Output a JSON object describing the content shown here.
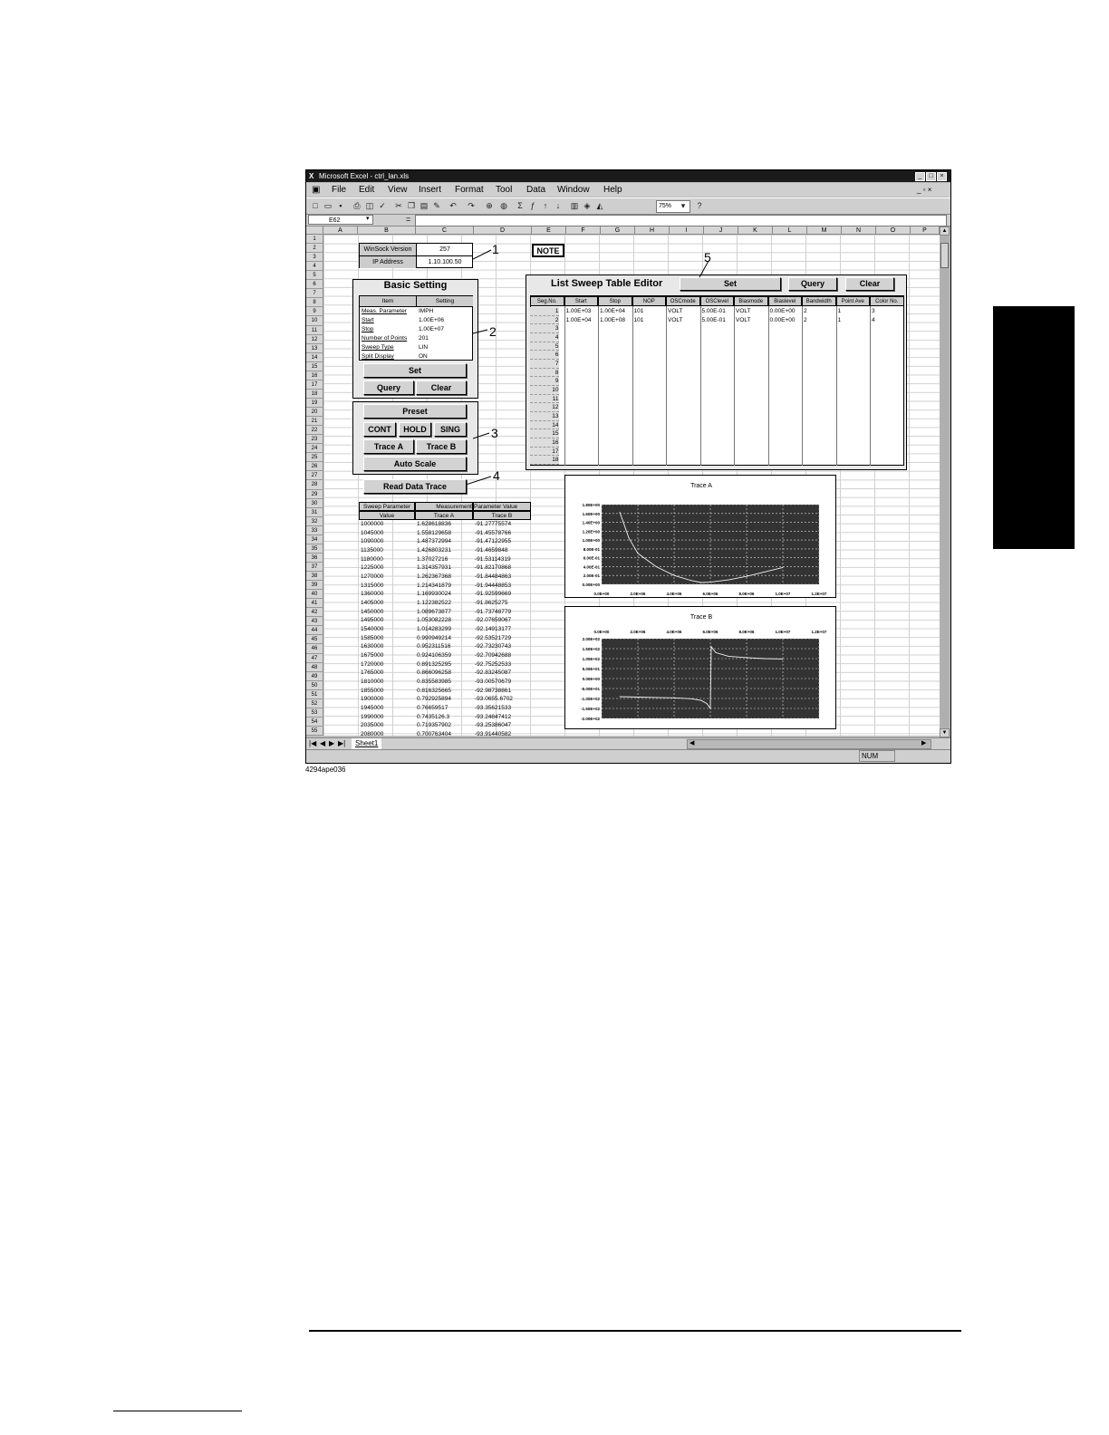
{
  "window": {
    "title": "Microsoft Excel - ctrl_lan.xls",
    "menu": [
      "File",
      "Edit",
      "View",
      "Insert",
      "Format",
      "Tool",
      "Data",
      "Window",
      "Help"
    ],
    "zoom": "75%",
    "name_box": "E62",
    "formula_eq": "="
  },
  "columns": [
    "A",
    "B",
    "C",
    "D",
    "E",
    "F",
    "G",
    "H",
    "I",
    "J",
    "K",
    "L",
    "M",
    "N",
    "O",
    "P"
  ],
  "rows": [
    "1",
    "2",
    "3",
    "4",
    "5",
    "6",
    "7",
    "8",
    "9",
    "10",
    "11",
    "12",
    "13",
    "14",
    "15",
    "16",
    "17",
    "18",
    "19",
    "20",
    "21",
    "22",
    "23",
    "24",
    "25",
    "26",
    "27",
    "28",
    "29",
    "30",
    "31",
    "32",
    "33",
    "34",
    "35",
    "36",
    "37",
    "38",
    "39",
    "40",
    "41",
    "42",
    "43",
    "44",
    "45",
    "46",
    "47",
    "48",
    "49",
    "50",
    "51",
    "52",
    "53",
    "54",
    "55"
  ],
  "info": {
    "winsock_label": "WinSock Version",
    "winsock_value": "257",
    "ip_label": "IP Address",
    "ip_value": "1.10.100.50",
    "note": "NOTE"
  },
  "basic": {
    "title": "Basic Setting",
    "col_item": "Item",
    "col_setting": "Setting",
    "items": [
      {
        "item": "Meas. Parameter",
        "setting": "IMPH"
      },
      {
        "item": "Start",
        "setting": "1.00E+06"
      },
      {
        "item": "Stop",
        "setting": "1.00E+07"
      },
      {
        "item": "Number of Points",
        "setting": "201"
      },
      {
        "item": "Sweep Type",
        "setting": "LIN"
      },
      {
        "item": "Split Display",
        "setting": "ON"
      }
    ],
    "set": "Set",
    "query": "Query",
    "clear": "Clear"
  },
  "control": {
    "preset": "Preset",
    "cont": "CONT",
    "hold": "HOLD",
    "sing": "SING",
    "trace_a": "Trace A",
    "trace_b": "Trace B",
    "auto_scale": "Auto Scale",
    "read_data": "Read Data Trace"
  },
  "callouts": [
    "1",
    "2",
    "3",
    "4",
    "5"
  ],
  "list_sweep": {
    "title": "List Sweep Table Editor",
    "set": "Set",
    "query": "Query",
    "clear": "Clear",
    "headers": [
      "Seg.No.",
      "Start",
      "Stop",
      "NOP",
      "OSCmode",
      "OSClevel",
      "Biasmode",
      "Biaslevel",
      "Bandwidth",
      "Point Ave",
      "Color No."
    ],
    "seg_numbers": [
      "1",
      "2",
      "3",
      "4",
      "5",
      "6",
      "7",
      "8",
      "9",
      "10",
      "11",
      "12",
      "13",
      "14",
      "15",
      "16",
      "17",
      "18"
    ],
    "rows": [
      [
        "1.00E+03",
        "1.00E+04",
        "101",
        "VOLT",
        "5.00E-01",
        "VOLT",
        "0.00E+00",
        "2",
        "1",
        "3"
      ],
      [
        "1.00E+04",
        "1.00E+08",
        "101",
        "VOLT",
        "5.00E-01",
        "VOLT",
        "0.00E+00",
        "2",
        "1",
        "4"
      ]
    ]
  },
  "data_table": {
    "h1": [
      "Sweep Parameter",
      "Measurement",
      "Parameter Value"
    ],
    "h2": [
      "Value",
      "Trace A",
      "Trace B"
    ],
    "rows": [
      [
        "1000000",
        "1.628618836",
        "-91.27775574"
      ],
      [
        "1045000",
        "1.558129658",
        "-91.45578766"
      ],
      [
        "1090000",
        "1.487372994",
        "-91.47122955"
      ],
      [
        "1135000",
        "1.426803231",
        "-91.4659848"
      ],
      [
        "1180000",
        "1.37027216",
        "-91.53114319"
      ],
      [
        "1225000",
        "1.314357931",
        "-91.82170868"
      ],
      [
        "1270000",
        "1.262367368",
        "-91.84484863"
      ],
      [
        "1315000",
        "1.214341879",
        "-91.94448853"
      ],
      [
        "1360000",
        "1.169930024",
        "-91.92599669"
      ],
      [
        "1405000",
        "1.122382522",
        "-91.8625275"
      ],
      [
        "1450000",
        "1.089673877",
        "-91.73748779"
      ],
      [
        "1495000",
        "1.053082228",
        "-92.07659067"
      ],
      [
        "1540000",
        "1.014283299",
        "-92.14913177"
      ],
      [
        "1585000",
        "0.990949214",
        "-92.53521729"
      ],
      [
        "1630000",
        "0.952311516",
        "-92.73230743"
      ],
      [
        "1675000",
        "0.924106359",
        "-92.70942688"
      ],
      [
        "1720000",
        "0.891325295",
        "-92.75252533"
      ],
      [
        "1765000",
        "0.866096258",
        "-92.83245087"
      ],
      [
        "1810000",
        "0.835583985",
        "-93.00570679"
      ],
      [
        "1855000",
        "0.816325665",
        "-92.98738861"
      ],
      [
        "1900000",
        "0.792925894",
        "-93.0655.6702"
      ],
      [
        "1945000",
        "0.76659517",
        "-93.35621533"
      ],
      [
        "1990000",
        "0.7435126.3",
        "-93.24847412"
      ],
      [
        "2035000",
        "0.719357902",
        "-93.25386047"
      ],
      [
        "2080000",
        "0.700763404",
        "-93.91440582"
      ]
    ]
  },
  "chart_data": [
    {
      "type": "line",
      "title": "Trace A",
      "y_ticks": [
        "1.80E+00",
        "1.60E+00",
        "1.40E+00",
        "1.20E+00",
        "1.00E+00",
        "8.00E-01",
        "6.00E-01",
        "4.00E-01",
        "2.00E-01",
        "0.00E+00"
      ],
      "x_ticks": [
        "0.0E+00",
        "2.0E+06",
        "4.0E+06",
        "6.0E+06",
        "8.0E+06",
        "1.0E+07",
        "1.2E+07"
      ],
      "xlim": [
        0,
        12000000
      ],
      "ylim": [
        0,
        1.8
      ],
      "grid": true,
      "x": [
        1000000,
        1500000,
        2000000,
        3000000,
        4000000,
        5000000,
        5500000,
        6000000,
        7000000,
        8000000,
        9000000,
        10000000
      ],
      "y": [
        1.63,
        1.05,
        0.7,
        0.4,
        0.2,
        0.08,
        0.04,
        0.05,
        0.1,
        0.18,
        0.28,
        0.38
      ]
    },
    {
      "type": "line",
      "title": "Trace B",
      "y_ticks": [
        "2.00E+02",
        "1.50E+02",
        "1.00E+02",
        "5.00E+01",
        "0.00E+00",
        "-5.00E+01",
        "-1.00E+02",
        "-1.50E+02",
        "-2.00E+02"
      ],
      "x_ticks": [
        "0.0E+00",
        "2.0E+06",
        "4.0E+06",
        "6.0E+06",
        "8.0E+06",
        "1.0E+07",
        "1.2E+07"
      ],
      "xlim": [
        0,
        12000000
      ],
      "ylim": [
        -200,
        200
      ],
      "grid": true,
      "x": [
        1000000,
        2000000,
        3000000,
        4000000,
        5000000,
        5500000,
        5800000,
        6000000,
        6050000,
        6300000,
        7000000,
        8000000,
        9000000,
        10000000
      ],
      "y": [
        -91,
        -93,
        -95,
        -97,
        -102,
        -110,
        -125,
        -150,
        160,
        130,
        112,
        105,
        100,
        98
      ]
    }
  ],
  "sheet_tab": "Sheet1",
  "status": "NUM",
  "figure_id": "4294ape036"
}
